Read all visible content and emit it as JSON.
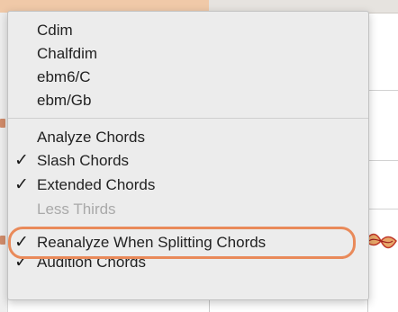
{
  "menu": {
    "items": [
      {
        "label": "Cdim",
        "checked": false,
        "disabled": false
      },
      {
        "label": "Chalfdim",
        "checked": false,
        "disabled": false
      },
      {
        "label": "ebm6/C",
        "checked": false,
        "disabled": false
      },
      {
        "label": "ebm/Gb",
        "checked": false,
        "disabled": false
      },
      {
        "label": "Analyze Chords",
        "checked": false,
        "disabled": false
      },
      {
        "label": "Slash Chords",
        "checked": true,
        "disabled": false
      },
      {
        "label": "Extended Chords",
        "checked": true,
        "disabled": false
      },
      {
        "label": "Less Thirds",
        "checked": false,
        "disabled": true
      },
      {
        "label": "Reanalyze When Splitting Chords",
        "checked": true,
        "disabled": false
      },
      {
        "label": "Audition Chords",
        "checked": true,
        "disabled": false
      }
    ],
    "check_glyph": "✓",
    "highlight_color": "#e98a5a"
  }
}
